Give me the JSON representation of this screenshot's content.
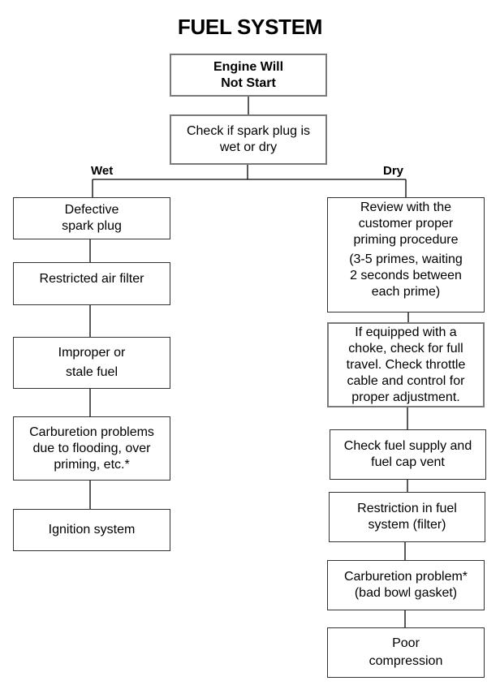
{
  "title": "FUEL SYSTEM",
  "root": {
    "lines": [
      "Engine Will",
      "Not Start"
    ]
  },
  "decision": {
    "lines": [
      "Check if spark plug is",
      "wet or dry"
    ]
  },
  "branches": {
    "wet": {
      "label": "Wet",
      "steps": [
        {
          "lines": [
            "Defective",
            "spark plug"
          ]
        },
        {
          "lines": [
            "Restricted air filter"
          ]
        },
        {
          "lines": [
            "Improper or",
            "stale fuel"
          ]
        },
        {
          "lines": [
            "Carburetion problems",
            "due to flooding, over",
            "priming, etc.*"
          ]
        },
        {
          "lines": [
            "Ignition system"
          ]
        }
      ]
    },
    "dry": {
      "label": "Dry",
      "steps": [
        {
          "lines": [
            "Review with the",
            "customer proper",
            "priming procedure"
          ],
          "note": [
            "(3-5 primes,  waiting",
            "2 seconds between",
            "each prime)"
          ]
        },
        {
          "lines": [
            "If equipped with a",
            "choke, check for full",
            "travel.  Check throttle",
            "cable and control for",
            "proper adjustment."
          ]
        },
        {
          "lines": [
            "Check fuel supply and",
            "fuel cap vent"
          ]
        },
        {
          "lines": [
            "Restriction in fuel",
            "system (filter)"
          ]
        },
        {
          "lines": [
            "Carburetion problem*",
            "(bad bowl gasket)"
          ]
        },
        {
          "lines": [
            "Poor",
            "compression"
          ]
        }
      ]
    }
  }
}
